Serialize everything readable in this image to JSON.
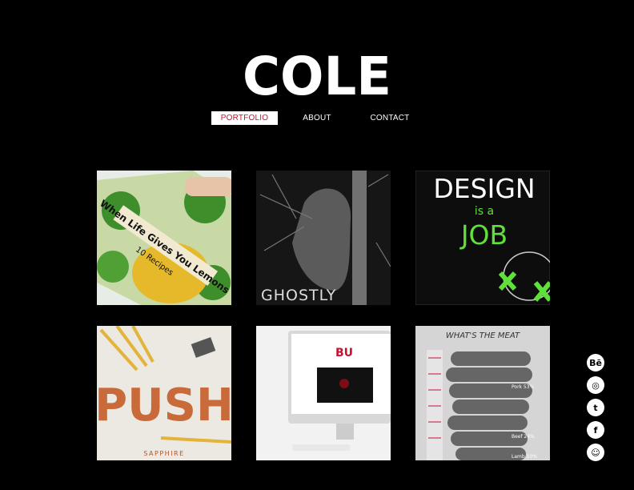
{
  "brand": {
    "logo_text": "COLE"
  },
  "nav": {
    "items": [
      {
        "label": "PORTFOLIO",
        "active": true
      },
      {
        "label": "ABOUT",
        "active": false
      },
      {
        "label": "CONTACT",
        "active": false
      }
    ]
  },
  "portfolio": {
    "tiles": [
      {
        "id": "lemons",
        "title": "When Life Gives You Lemons",
        "subtitle": "10 Recipes"
      },
      {
        "id": "ghostly",
        "title": "GHOSTLY"
      },
      {
        "id": "design-job",
        "line1": "DESIGN",
        "line2": "is a",
        "line3": "JOB"
      },
      {
        "id": "push",
        "title": "PUSH",
        "subtitle": "SAPPHIRE"
      },
      {
        "id": "website",
        "logo": "BU"
      },
      {
        "id": "meat",
        "title": "WHAT'S THE MEAT",
        "labels": [
          "Pork 53%",
          "Beef 24%",
          "Lamb 10%"
        ]
      }
    ]
  },
  "social": {
    "items": [
      {
        "name": "behance",
        "glyph": "Bē"
      },
      {
        "name": "instagram",
        "glyph": "◎"
      },
      {
        "name": "tumblr",
        "glyph": "t"
      },
      {
        "name": "facebook",
        "glyph": "f"
      },
      {
        "name": "snapchat",
        "glyph": "☺"
      }
    ]
  },
  "colors": {
    "background": "#000000",
    "accent": "#c8102e",
    "green": "#5fe03a"
  }
}
